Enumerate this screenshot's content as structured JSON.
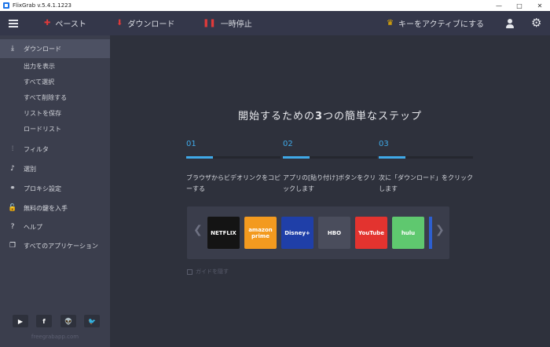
{
  "window": {
    "title": "FlixGrab  v.5.4.1.1223",
    "controls": [
      "—",
      "□",
      "✕"
    ]
  },
  "toolbar": {
    "paste_label": "ペースト",
    "download_label": "ダウンロード",
    "pause_label": "一時停止",
    "activate_label": "キーをアクティブにする"
  },
  "sidebar": {
    "download": "ダウンロード",
    "sub_items": [
      "出力を表示",
      "すべて選択",
      "すべて削除する",
      "リストを保存",
      "ロードリスト"
    ],
    "filter": "フィルタ",
    "selection": "選別",
    "proxy": "プロキシ設定",
    "free_key": "無料の鍵を入手",
    "help": "ヘルプ",
    "all_apps": "すべてのアプリケーション",
    "social": [
      "▶",
      "f",
      "👽",
      "🐦"
    ],
    "url": "freegrabapp.com"
  },
  "main": {
    "headline_pre": "開始するための",
    "headline_num": "3",
    "headline_post": "つの簡単なステップ",
    "steps": [
      {
        "num": "01",
        "text": "ブラウザからビデオリンクをコピーする",
        "progress": 0.28
      },
      {
        "num": "02",
        "text": "アプリの[貼り付け]ボタンをクリックします",
        "progress": 0.28
      },
      {
        "num": "03",
        "text": "次に「ダウンロード」をクリックします",
        "progress": 0.28
      }
    ],
    "services": [
      "NETFLIX",
      "amazon prime",
      "Disney+",
      "HBO",
      "YouTube",
      "hulu"
    ],
    "service_colors": [
      "#141414",
      "#f39a1f",
      "#1f3fa8",
      "#4a4d5c",
      "#e3332f",
      "#5fc86f"
    ],
    "hide_label": "ガイドを隠す"
  }
}
